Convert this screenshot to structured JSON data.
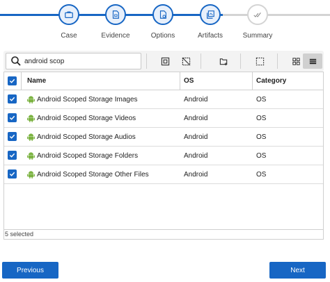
{
  "stepper": {
    "steps": [
      {
        "label": "Case",
        "icon": "briefcase-icon",
        "state": "done"
      },
      {
        "label": "Evidence",
        "icon": "evidence-file-icon",
        "state": "done"
      },
      {
        "label": "Options",
        "icon": "options-file-icon",
        "state": "done"
      },
      {
        "label": "Artifacts",
        "icon": "artifacts-icon",
        "state": "current"
      },
      {
        "label": "Summary",
        "icon": "summary-check-icon",
        "state": "pending"
      }
    ],
    "colors": {
      "active": "#1766c4",
      "inactive": "#d4d4d4"
    }
  },
  "toolbar": {
    "search_value": "android scop",
    "buttons": [
      "select-all-icon",
      "deselect-icon",
      "add-file-icon",
      "select-region-icon",
      "grid-view-icon",
      "list-view-icon"
    ]
  },
  "table": {
    "columns": [
      "Name",
      "OS",
      "Category"
    ],
    "rows": [
      {
        "name": "Android Scoped Storage Images",
        "os": "Android",
        "category": "OS",
        "checked": true
      },
      {
        "name": "Android Scoped Storage Videos",
        "os": "Android",
        "category": "OS",
        "checked": true
      },
      {
        "name": "Android Scoped Storage Audios",
        "os": "Android",
        "category": "OS",
        "checked": true
      },
      {
        "name": "Android Scoped Storage Folders",
        "os": "Android",
        "category": "OS",
        "checked": true
      },
      {
        "name": "Android Scoped Storage Other Files",
        "os": "Android",
        "category": "OS",
        "checked": true
      }
    ],
    "selected_text": "5 selected"
  },
  "nav": {
    "previous_label": "Previous",
    "next_label": "Next"
  },
  "colors": {
    "accent": "#1766c4",
    "android_green": "#7cb342"
  }
}
